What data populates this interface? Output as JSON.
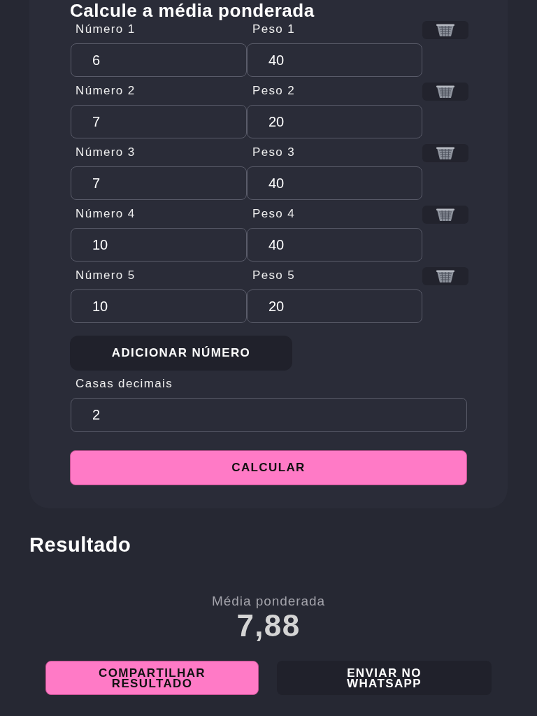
{
  "form": {
    "title": "Calcule a média ponderada",
    "rows": [
      {
        "number_label": "Número 1",
        "number_value": "6",
        "weight_label": "Peso 1",
        "weight_value": "40"
      },
      {
        "number_label": "Número 2",
        "number_value": "7",
        "weight_label": "Peso 2",
        "weight_value": "20"
      },
      {
        "number_label": "Número 3",
        "number_value": "7",
        "weight_label": "Peso 3",
        "weight_value": "40"
      },
      {
        "number_label": "Número 4",
        "number_value": "10",
        "weight_label": "Peso 4",
        "weight_value": "40"
      },
      {
        "number_label": "Número 5",
        "number_value": "10",
        "weight_label": "Peso 5",
        "weight_value": "20"
      }
    ],
    "add_button": "ADICIONAR NÚMERO",
    "decimals": {
      "label": "Casas decimais",
      "value": "2"
    },
    "calculate_button": "CALCULAR"
  },
  "result": {
    "heading": "Resultado",
    "label": "Média ponderada",
    "value": "7,88",
    "buttons": [
      {
        "label": "COMPARTILHAR RESULTADO",
        "kind": "primary"
      },
      {
        "label": "ENVIAR NO WHATSAPP",
        "kind": "secondary"
      }
    ]
  }
}
